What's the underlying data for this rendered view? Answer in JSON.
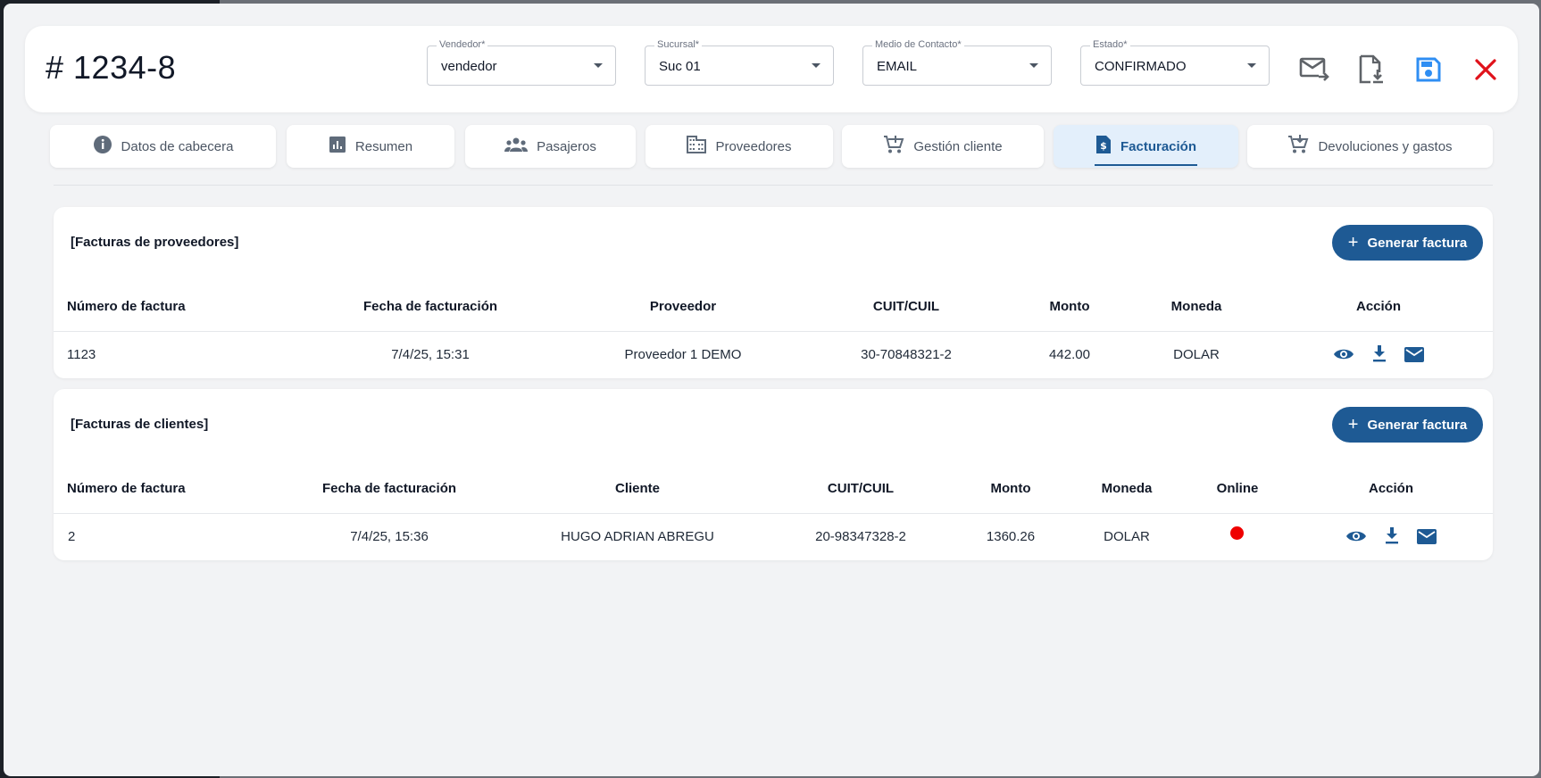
{
  "header": {
    "title": "# 1234-8",
    "fields": [
      {
        "label": "Vendedor*",
        "value": "vendedor"
      },
      {
        "label": "Sucursal*",
        "value": "Suc 01"
      },
      {
        "label": "Medio de Contacto*",
        "value": "EMAIL"
      },
      {
        "label": "Estado*",
        "value": "CONFIRMADO"
      }
    ],
    "actions": [
      "mail-forward-icon",
      "file-download-icon",
      "save-icon",
      "close-icon"
    ]
  },
  "tabs": [
    {
      "label": "Datos de cabecera",
      "icon": "info-icon"
    },
    {
      "label": "Resumen",
      "icon": "chart-icon"
    },
    {
      "label": "Pasajeros",
      "icon": "group-icon"
    },
    {
      "label": "Proveedores",
      "icon": "building-icon"
    },
    {
      "label": "Gestión cliente",
      "icon": "cart-add-icon"
    },
    {
      "label": "Facturación",
      "icon": "invoice-icon",
      "active": true
    },
    {
      "label": "Devoluciones y gastos",
      "icon": "cart-return-icon"
    }
  ],
  "proveedores": {
    "title": "[Facturas de proveedores]",
    "button": "Generar factura",
    "columns": [
      "Número de factura",
      "Fecha de facturación",
      "Proveedor",
      "CUIT/CUIL",
      "Monto",
      "Moneda",
      "Acción"
    ],
    "rows": [
      {
        "numero": "1123",
        "fecha": "7/4/25, 15:31",
        "proveedor": "Proveedor 1 DEMO",
        "cuit": "30-70848321-2",
        "monto": "442.00",
        "moneda": "DOLAR"
      }
    ]
  },
  "clientes": {
    "title": "[Facturas de clientes]",
    "button": "Generar factura",
    "columns": [
      "Número de factura",
      "Fecha de facturación",
      "Cliente",
      "CUIT/CUIL",
      "Monto",
      "Moneda",
      "Online",
      "Acción"
    ],
    "rows": [
      {
        "numero": "2",
        "fecha": "7/4/25, 15:36",
        "cliente": "HUGO ADRIAN ABREGU",
        "cuit": "20-98347328-2",
        "monto": "1360.26",
        "moneda": "DOLAR",
        "online_status": "offline"
      }
    ]
  },
  "colors": {
    "primary": "#1e5a94",
    "save": "#2f8ef3",
    "close": "#e0121b",
    "offline": "#ef0000"
  }
}
